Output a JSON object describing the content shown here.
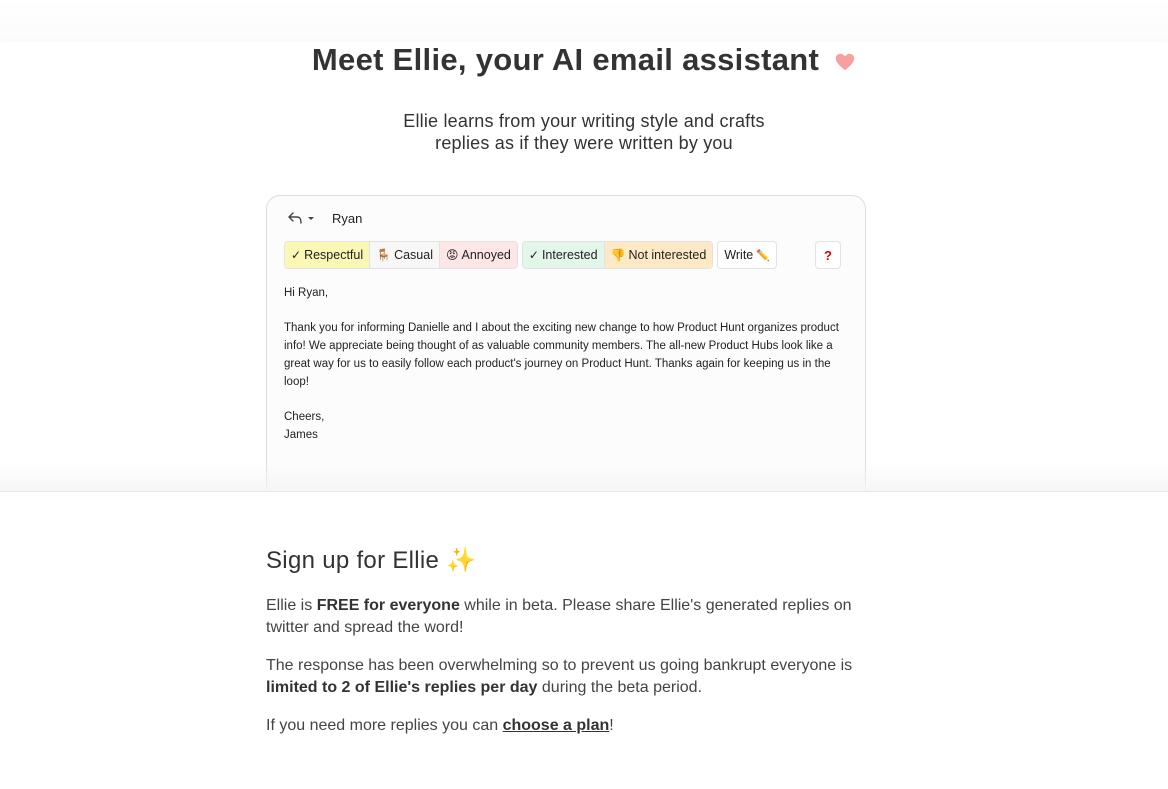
{
  "hero": {
    "title": "Meet Ellie, your AI email assistant",
    "title_icon": "heart-icon",
    "subtitle_line1": "Ellie learns from your writing style and crafts",
    "subtitle_line2": "replies as if they were written by you"
  },
  "email_card": {
    "recipient": "Ryan",
    "tone_buttons_1": [
      {
        "label": "Respectful",
        "glyph": "✓"
      },
      {
        "label": "Casual",
        "glyph": "🪑"
      },
      {
        "label": "Annoyed",
        "glyph": "😡"
      }
    ],
    "tone_buttons_2": [
      {
        "label": "Interested",
        "glyph": "✓"
      },
      {
        "label": "Not interested",
        "glyph": "👎"
      }
    ],
    "write_label": "Write",
    "write_icon": "✏️",
    "help_label": "?",
    "greeting": "Hi Ryan,",
    "body": "Thank you for informing Danielle and I about the exciting new change to how Product Hunt organizes product info! We appreciate being thought of as valuable community members. The all-new Product Hubs look like a great way for us to easily follow each product's journey on Product Hunt. Thanks again for keeping us in the loop!",
    "signoff": "Cheers,",
    "signature": "James"
  },
  "signup": {
    "title": "Sign up for Ellie ✨",
    "p1_a": "Ellie is ",
    "p1_bold": "FREE for everyone",
    "p1_b": " while in beta. Please share Ellie's generated replies on twitter and spread the word!",
    "p2_a": "The response has been overwhelming so to prevent us going bankrupt everyone is ",
    "p2_bold": "limited to 2 of Ellie's replies per day",
    "p2_b": " during the beta period.",
    "p3_a": "If you need more replies you can ",
    "p3_link": "choose a plan",
    "p3_b": "!"
  },
  "colors": {
    "respectful_bg": "#fbf7b4",
    "annoyed_bg": "#fde6e6",
    "interested_bg": "#e2f6ea",
    "not_interested_bg": "#fde9c6",
    "heart": "#f7a0a0",
    "help_mark": "#d40000"
  }
}
